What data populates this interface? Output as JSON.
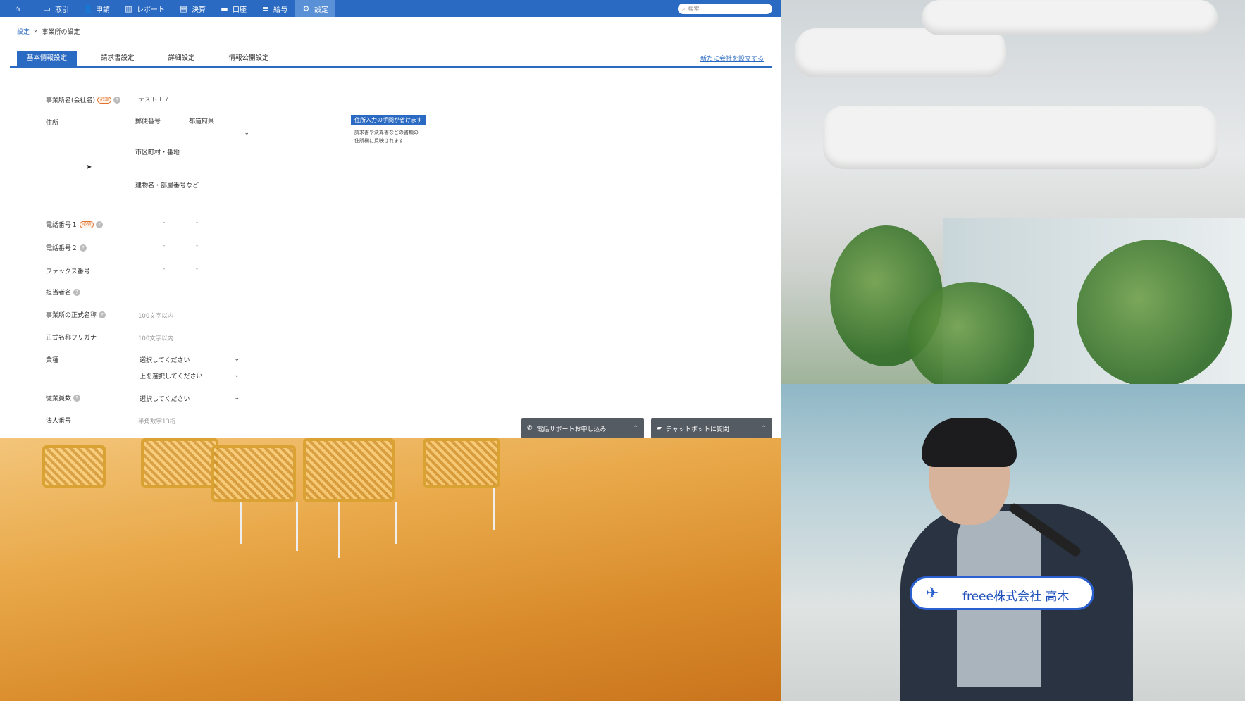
{
  "nav": {
    "items": [
      {
        "label": "",
        "icon": "home-icon",
        "glyph": "⌂"
      },
      {
        "label": "取引",
        "icon": "monitor-icon",
        "glyph": "▭"
      },
      {
        "label": "申請",
        "icon": "user-icon",
        "glyph": "👤"
      },
      {
        "label": "レポート",
        "icon": "chart-icon",
        "glyph": "▥"
      },
      {
        "label": "決算",
        "icon": "book-icon",
        "glyph": "▤"
      },
      {
        "label": "口座",
        "icon": "card-icon",
        "glyph": "▬"
      },
      {
        "label": "給与",
        "icon": "document-icon",
        "glyph": "≡"
      },
      {
        "label": "設定",
        "icon": "gear-icon",
        "glyph": "⚙"
      }
    ],
    "search_placeholder": "検索"
  },
  "breadcrumb": {
    "link": "設定",
    "separator": "»",
    "current": "事業所の設定"
  },
  "tabs": {
    "items": [
      "基本情報設定",
      "請求書設定",
      "詳細設定",
      "情報公開設定"
    ],
    "new_company_link": "新たに会社を設立する"
  },
  "form": {
    "company_name": {
      "label": "事業所名(会社名)",
      "required": "必須",
      "value": "テスト１７"
    },
    "address": {
      "label": "住所",
      "postal_label": "郵便番号",
      "prefecture_label": "都道府県",
      "city_label": "市区町村・番地",
      "building_label": "建物名・部屋番号など",
      "tip_title": "住所入力の手間が省けます",
      "tip_line1": "請求書や決算書などの書類の",
      "tip_line2": "住所欄に反映されます"
    },
    "phone1": {
      "label": "電話番号１",
      "required": "必須"
    },
    "phone2": {
      "label": "電話番号２"
    },
    "fax": {
      "label": "ファックス番号"
    },
    "dash": "-",
    "contact_name": {
      "label": "担当者名"
    },
    "official_name": {
      "label": "事業所の正式名称",
      "placeholder": "100文字以内"
    },
    "official_kana": {
      "label": "正式名称フリガナ",
      "placeholder": "100文字以内"
    },
    "industry": {
      "label": "業種",
      "select1": "選択してください",
      "select2": "上を選択してください"
    },
    "employees": {
      "label": "従業員数",
      "select": "選択してください"
    },
    "corporate_number": {
      "label": "法人番号",
      "placeholder": "半角数字13桁"
    }
  },
  "support": {
    "phone_button": "電話サポートお申し込み",
    "chat_button": "チャットボットに質問"
  },
  "webcam": {
    "caption": "freee株式会社 高木"
  }
}
